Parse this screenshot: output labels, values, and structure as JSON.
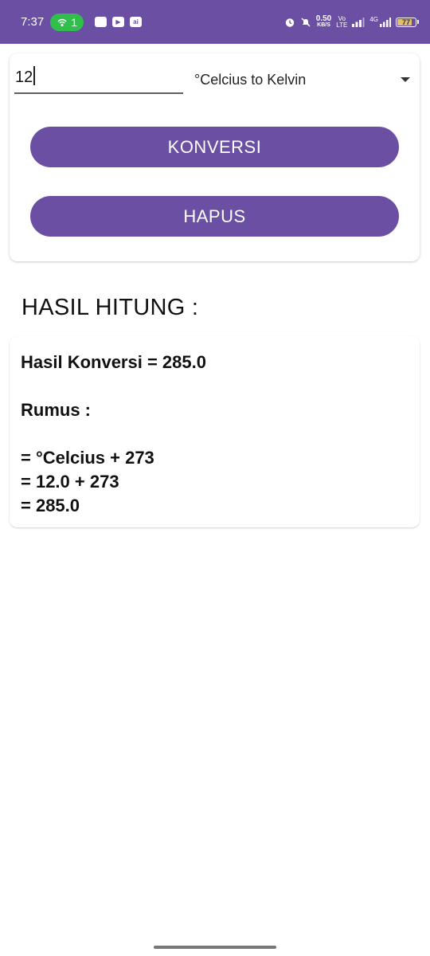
{
  "status_bar": {
    "time": "7:37",
    "hotspot_count": "1",
    "app_icon_labels": [
      "",
      "▶",
      "ai"
    ],
    "net_speed_value": "0.50",
    "net_speed_unit": "KB/S",
    "volte_top": "Vo",
    "volte_bottom": "LTE",
    "network_type": "4G",
    "battery_level": "77"
  },
  "converter": {
    "input_value": "12",
    "conversion_selected": "°Celcius to Kelvin",
    "konversi_button": "KONVERSI",
    "hapus_button": "HAPUS"
  },
  "result": {
    "heading": "HASIL HITUNG :",
    "hasil_line": "Hasil Konversi = 285.0",
    "rumus_label": "Rumus :",
    "formula_lines": [
      "= °Celcius + 273",
      "= 12.0 + 273",
      "= 285.0"
    ]
  },
  "colors": {
    "primary": "#6a4fa3",
    "hotspot": "#2fbf4a"
  }
}
